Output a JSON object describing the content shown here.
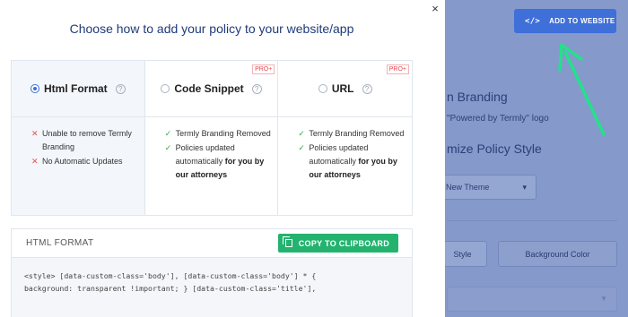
{
  "background": {
    "add_button_icon": "</>",
    "add_button_label": "ADD TO WEBSITE",
    "branding": "n Branding",
    "powered_by": "\"Powered by Termly\" logo",
    "customize": "mize Policy Style",
    "theme_select": "New Theme",
    "style_button": "Style",
    "background_color_button": "Background Color",
    "arrow_color": "#22e28a"
  },
  "modal": {
    "title": "Choose how to add your policy to your website/app",
    "close_glyph": "×",
    "options": [
      {
        "label": "Html Format",
        "selected": true,
        "badge": "",
        "features": [
          {
            "type": "x",
            "text": "Unable to remove Termly Branding",
            "bold": ""
          },
          {
            "type": "x",
            "text": "No Automatic Updates",
            "bold": ""
          }
        ]
      },
      {
        "label": "Code Snippet",
        "selected": false,
        "badge": "PRO+",
        "features": [
          {
            "type": "ok",
            "text": "Termly Branding Removed",
            "bold": ""
          },
          {
            "type": "ok",
            "text": "Policies updated automatically",
            "bold": " for you by our attorneys"
          }
        ]
      },
      {
        "label": "URL",
        "selected": false,
        "badge": "PRO+",
        "features": [
          {
            "type": "ok",
            "text": "Termly Branding Removed",
            "bold": ""
          },
          {
            "type": "ok",
            "text": "Policies updated automatically",
            "bold": " for you by our attorneys"
          }
        ]
      }
    ],
    "code_panel": {
      "title": "HTML FORMAT",
      "copy_label": "COPY TO CLIPBOARD",
      "code_line1": "<style> [data-custom-class='body'], [data-custom-class='body'] * {",
      "code_line2": "background: transparent !important; } [data-custom-class='title'],"
    }
  },
  "colors": {
    "accent": "#3a6fd8",
    "title": "#1f3b7a",
    "copy_button": "#23b36f",
    "pro_badge": "#e0474c"
  }
}
